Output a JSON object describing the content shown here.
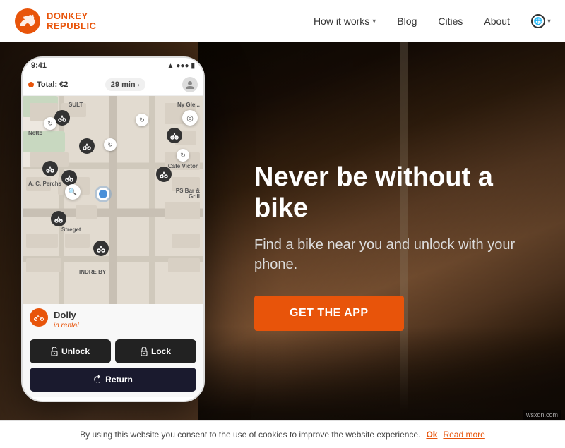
{
  "nav": {
    "logo_text_line1": "DONKEY",
    "logo_text_line2": "REPUBLIC",
    "links": [
      {
        "label": "How it works",
        "has_chevron": true,
        "name": "how-it-works"
      },
      {
        "label": "Blog",
        "has_chevron": false,
        "name": "blog"
      },
      {
        "label": "Cities",
        "has_chevron": false,
        "name": "cities"
      },
      {
        "label": "About",
        "has_chevron": false,
        "name": "about"
      }
    ]
  },
  "hero": {
    "title": "Never be without a bike",
    "subtitle": "Find a bike near you and unlock with your phone.",
    "cta_label": "GET THE APP"
  },
  "phone": {
    "status_time": "9:41",
    "ride_info": "Total: €2",
    "ride_duration": "29 min",
    "bike_name": "Dolly",
    "bike_status": "in rental",
    "unlock_label": "Unlock",
    "lock_label": "Lock",
    "return_label": "Return",
    "map_labels": [
      "SULT",
      "Netto",
      "A. C. Perchs\nThehand...",
      "Cafe Victor",
      "PS Bar &\nGrill",
      "Streget",
      "INDRE BY",
      "Ny Gle..."
    ]
  },
  "cookie": {
    "text": "By using this website you consent to the use of cookies to improve the website experience.",
    "ok_label": "Ok",
    "read_more_label": "Read more"
  },
  "wsxdn": "wsxdn.com"
}
